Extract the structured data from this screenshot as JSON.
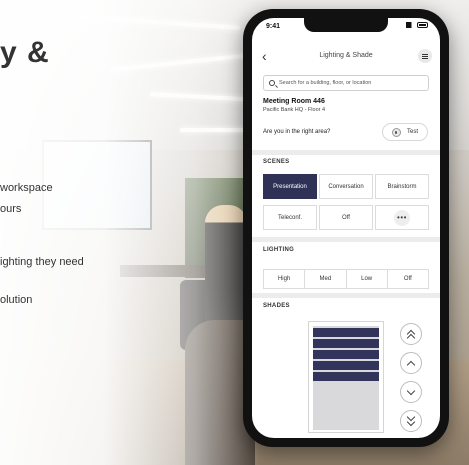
{
  "hero": {
    "title": "y &",
    "lines": [
      "workspace",
      "ours",
      "ighting they need",
      "olution"
    ]
  },
  "status_bar": {
    "time": "9:41"
  },
  "nav": {
    "title": "Lighting & Shade"
  },
  "search": {
    "placeholder": "Search for a building, floor, or location"
  },
  "room": {
    "name": "Meeting Room 446",
    "location": "Pacific Bank HQ - Floor 4"
  },
  "area_check": {
    "question": "Are you in the right area?",
    "test_label": "Test"
  },
  "scenes": {
    "label": "SCENES",
    "items": [
      "Presentation",
      "Conversation",
      "Brainstorm",
      "Teleconf.",
      "Off"
    ],
    "active": "Presentation",
    "more": "•••"
  },
  "lighting": {
    "label": "LIGHTING",
    "items": [
      "High",
      "Med",
      "Low",
      "Off"
    ]
  },
  "shades": {
    "label": "SHADES",
    "slats_shown": 5
  },
  "colors": {
    "accent": "#2f3157",
    "shade_fill": "#33345b"
  }
}
